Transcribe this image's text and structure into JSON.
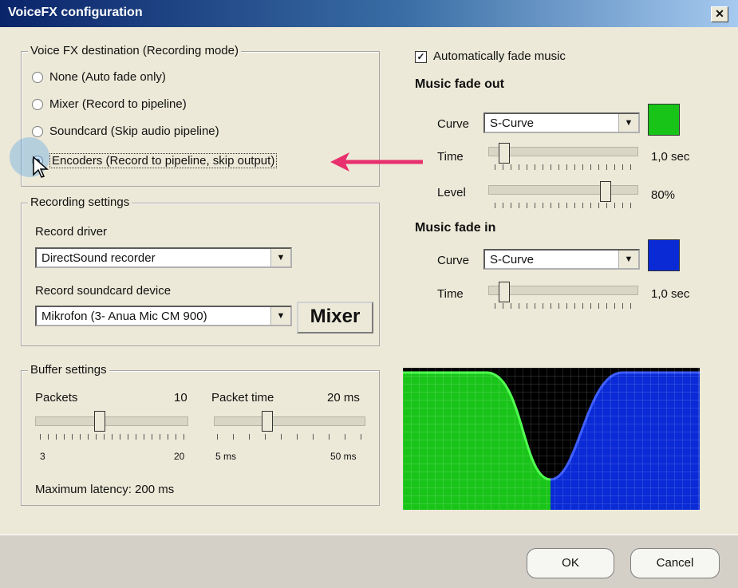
{
  "window": {
    "title": "VoiceFX configuration",
    "close_glyph": "✕"
  },
  "destination": {
    "legend": "Voice FX destination (Recording mode)",
    "options": [
      {
        "label": "None (Auto fade only)",
        "selected": false
      },
      {
        "label": "Mixer (Record to pipeline)",
        "selected": false
      },
      {
        "label": "Soundcard (Skip audio pipeline)",
        "selected": false
      },
      {
        "label": "Encoders (Record to pipeline, skip output)",
        "selected": true
      }
    ]
  },
  "recording": {
    "legend": "Recording settings",
    "driver_label": "Record driver",
    "driver_value": "DirectSound recorder",
    "device_label": "Record soundcard device",
    "device_value": "Mikrofon (3- Anua Mic CM 900)",
    "mixer_button": "Mixer"
  },
  "buffer": {
    "legend": "Buffer settings",
    "packets_label": "Packets",
    "packets_value": "10",
    "packets_min": "3",
    "packets_max": "20",
    "packet_time_label": "Packet time",
    "packet_time_value": "20 ms",
    "packet_time_min": "5 ms",
    "packet_time_max": "50 ms",
    "latency": "Maximum latency: 200 ms"
  },
  "music": {
    "auto_fade_label": "Automatically fade music",
    "auto_fade_checked": true,
    "fade_out": {
      "heading": "Music fade out",
      "curve_label": "Curve",
      "curve_value": "S-Curve",
      "time_label": "Time",
      "time_value": "1,0 sec",
      "level_label": "Level",
      "level_value": "80%"
    },
    "fade_in": {
      "heading": "Music fade in",
      "curve_label": "Curve",
      "curve_value": "S-Curve",
      "time_label": "Time",
      "time_value": "1,0 sec"
    },
    "fade_out_color": "#19c419",
    "fade_in_color": "#0a2ad6"
  },
  "buttons": {
    "ok": "OK",
    "cancel": "Cancel"
  },
  "annotation": {
    "arrow_color": "#e8306e"
  }
}
